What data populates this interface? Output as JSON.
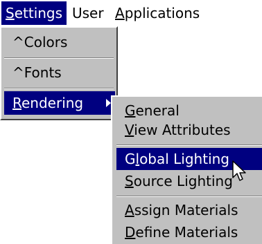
{
  "menubar": {
    "settings": {
      "mnemonic": "S",
      "rest": "ettings"
    },
    "user": {
      "label": "User"
    },
    "applications": {
      "mnemonic": "A",
      "rest": "pplications"
    }
  },
  "settings_menu": {
    "colors": {
      "prefix": "^",
      "rest": "Colors"
    },
    "fonts": {
      "prefix": "^",
      "rest": "Fonts"
    },
    "rendering": {
      "mnemonic": "R",
      "rest": "endering",
      "has_submenu": true
    }
  },
  "rendering_submenu": {
    "general": {
      "mnemonic": "G",
      "rest": "eneral"
    },
    "view_attributes": {
      "mnemonic": "V",
      "rest": "iew Attributes"
    },
    "global_lighting": {
      "pre": "G",
      "mnemonic": "l",
      "rest": "obal Lighting"
    },
    "source_lighting": {
      "mnemonic": "S",
      "rest": "ource Lighting"
    },
    "assign_materials": {
      "mnemonic": "A",
      "rest": "ssign Materials"
    },
    "define_materials": {
      "mnemonic": "D",
      "rest": "efine Materials"
    }
  },
  "colors": {
    "highlight": "#000080",
    "menu_bg": "#c0c0c0",
    "window_bg": "#ffffff"
  },
  "icons": {
    "submenu_arrow": "triangle-right",
    "pointer": "arrow-cursor"
  }
}
